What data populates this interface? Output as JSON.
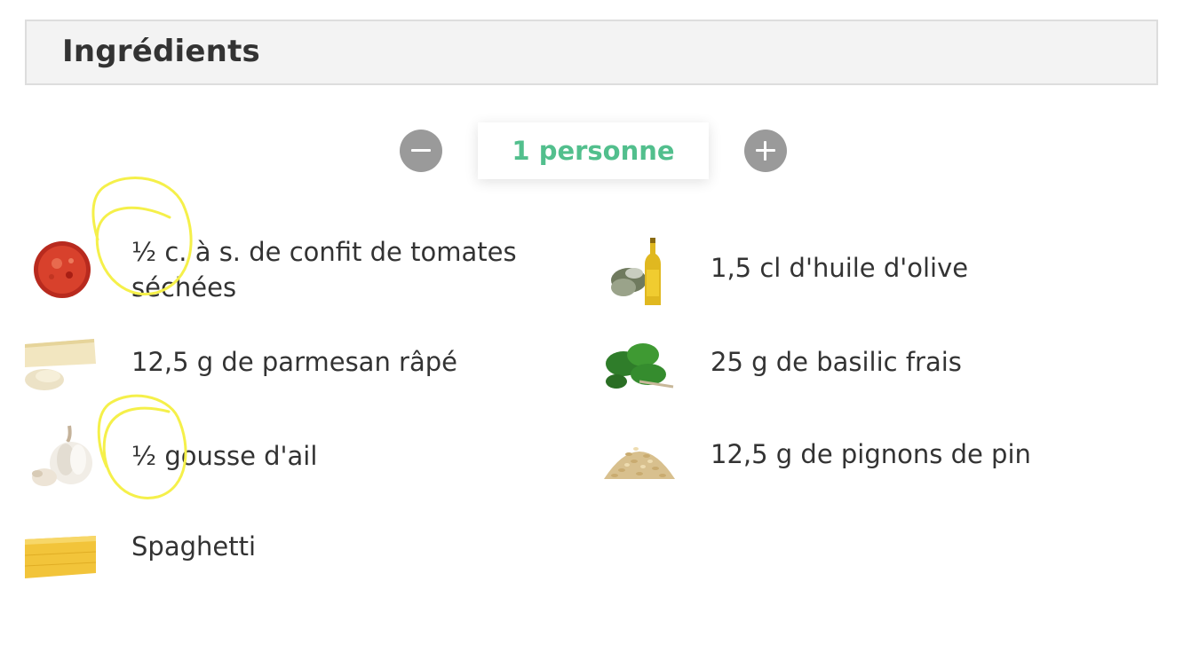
{
  "section": {
    "title": "Ingrédients"
  },
  "servings": {
    "label": "1 personne",
    "accent": "#52bf8d"
  },
  "ingredients": [
    {
      "text": "½ c. à s. de confit de tomates séchées",
      "icon": "tomato-confit-image"
    },
    {
      "text": "1,5 cl d'huile d'olive",
      "icon": "olive-oil-image"
    },
    {
      "text": "12,5 g de parmesan râpé",
      "icon": "parmesan-image"
    },
    {
      "text": "25 g de basilic frais",
      "icon": "basil-image"
    },
    {
      "text": "½ gousse d'ail",
      "icon": "garlic-image"
    },
    {
      "text": "12,5 g de pignons de pin",
      "icon": "pine-nuts-image"
    },
    {
      "text": "Spaghetti",
      "icon": "spaghetti-image"
    }
  ],
  "annotation_color": "#f5f04a"
}
